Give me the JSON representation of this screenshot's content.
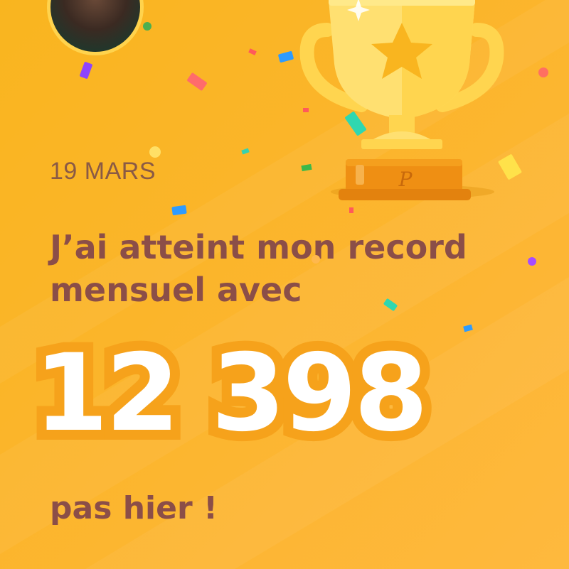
{
  "card": {
    "date": "19 MARS",
    "headline": "J’ai atteint mon record mensuel avec",
    "step_count": "12 398",
    "footer": "pas hier !"
  },
  "icons": {
    "avatar": "user-avatar-photo",
    "trophy": "gold-trophy-star-icon",
    "confetti": "confetti-decoration"
  },
  "colors": {
    "background": "#fbb52a",
    "text_accent": "#8b4e48",
    "number_outline": "#f6a21b",
    "trophy_gold": "#ffd54f"
  }
}
